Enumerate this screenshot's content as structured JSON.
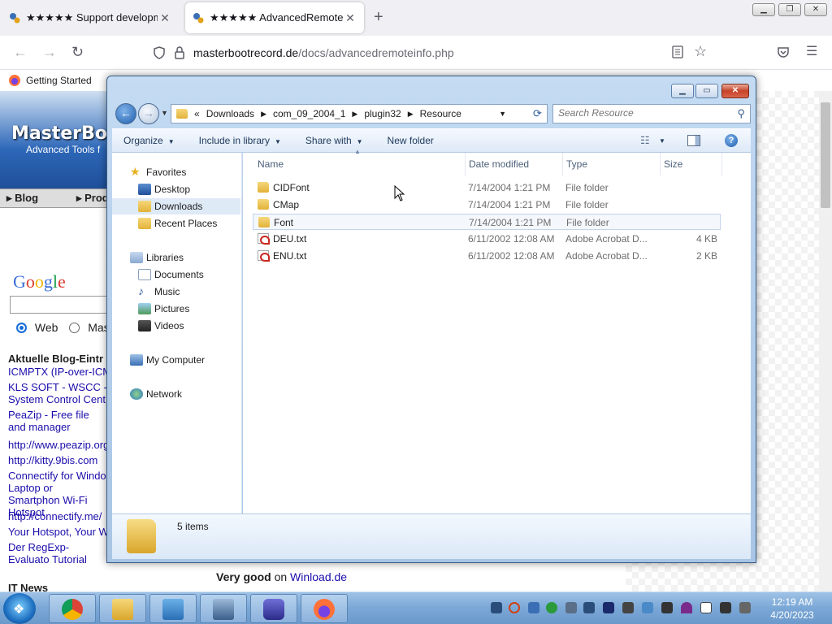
{
  "browser": {
    "tabs": [
      {
        "title": "★★★★★ Support development",
        "active": false
      },
      {
        "title": "★★★★★ AdvancedRemoteInfo",
        "active": true
      }
    ],
    "new_tab": "+",
    "url_host": "masterbootrecord.de",
    "url_path": "/docs/advancedremoteinfo.php",
    "bookmark": "Getting Started",
    "window_controls": {
      "minimize": "▁",
      "maximize": "❐",
      "close": "✕"
    }
  },
  "webpage": {
    "logo": "MasterBoo",
    "tagline": "Advanced Tools f",
    "menu": [
      "Blog",
      "Prod"
    ],
    "google": "Google",
    "radio_web": "Web",
    "radio_master": "Maste",
    "blog_heading": "Aktuelle Blog-Eintr",
    "blog_links": [
      "ICMPTX (IP-over-ICM",
      "KLS SOFT - WSCC - System Control Cent",
      "PeaZip - Free file and manager",
      "http://www.peazip.org",
      "http://kitty.9bis.com",
      "Connectify for Windo Laptop or Smartphon Wi-Fi Hotspot",
      "http://connectify.me/",
      "Your Hotspot, Your W",
      "Der RegExp-Evaluato Tutorial"
    ],
    "it_news": "IT News",
    "very_good": "Very good",
    "very_good_on": "on",
    "very_good_link": "Winload.de"
  },
  "explorer": {
    "window_controls": {
      "minimize": "▁",
      "maximize": "▭",
      "close": "✕"
    },
    "breadcrumb": [
      "«",
      "Downloads",
      "com_09_2004_1",
      "plugin32",
      "Resource"
    ],
    "search_placeholder": "Search Resource",
    "commands": [
      "Organize",
      "Include in library",
      "Share with",
      "New folder"
    ],
    "nav": {
      "favorites_header": "Favorites",
      "favorites": [
        "Desktop",
        "Downloads",
        "Recent Places"
      ],
      "libraries_header": "Libraries",
      "libraries": [
        "Documents",
        "Music",
        "Pictures",
        "Videos"
      ],
      "computer": "My Computer",
      "network": "Network"
    },
    "columns": {
      "name": "Name",
      "date": "Date modified",
      "type": "Type",
      "size": "Size"
    },
    "files": [
      {
        "name": "CIDFont",
        "date": "7/14/2004 1:21 PM",
        "type": "File folder",
        "size": "",
        "icon": "folder-icon"
      },
      {
        "name": "CMap",
        "date": "7/14/2004 1:21 PM",
        "type": "File folder",
        "size": "",
        "icon": "folder-icon"
      },
      {
        "name": "Font",
        "date": "7/14/2004 1:21 PM",
        "type": "File folder",
        "size": "",
        "icon": "folder-icon"
      },
      {
        "name": "DEU.txt",
        "date": "6/11/2002 12:08 AM",
        "type": "Adobe Acrobat D...",
        "size": "4 KB",
        "icon": "pdf-icon"
      },
      {
        "name": "ENU.txt",
        "date": "6/11/2002 12:08 AM",
        "type": "Adobe Acrobat D...",
        "size": "2 KB",
        "icon": "pdf-icon"
      }
    ],
    "item_count": "5 items"
  },
  "taskbar": {
    "time": "12:19 AM",
    "date": "4/20/2023"
  }
}
